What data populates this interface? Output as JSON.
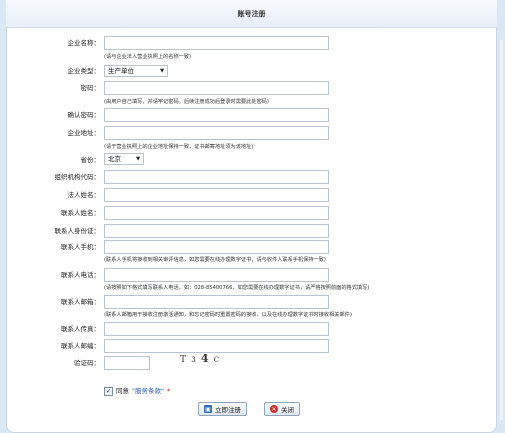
{
  "title": "账号注册",
  "fields": {
    "company_name": {
      "label": "企业名称：",
      "hint": "(请与企业法人营业执照上的名称一致)"
    },
    "company_type": {
      "label": "企业类型：",
      "value": "生产单位"
    },
    "password": {
      "label": "密码：",
      "hint": "(由用户自己填写，并请牢记密码。后续注册成功后登录时需要此处密码)"
    },
    "confirm_password": {
      "label": "确认密码："
    },
    "company_address": {
      "label": "企业地址：",
      "hint": "(请于营业执照上的企业地址保持一致，证书邮寄地址须为该地址)"
    },
    "province": {
      "label": "省份：",
      "value": "北京"
    },
    "org_code": {
      "label": "组织机构代码："
    },
    "legal_person": {
      "label": "法人姓名："
    },
    "contact_name": {
      "label": "联系人姓名："
    },
    "contact_id": {
      "label": "联系人身份证："
    },
    "contact_mobile": {
      "label": "联系人手机：",
      "hint": "(联系人手机将接收到相关审评信息，如您需要在线办理数字证书，请与收件人联系手机保持一致)"
    },
    "contact_phone": {
      "label": "联系人电话：",
      "hint": "(请按照如下格式填写联系人电话，如：028-85400766，如您需要在线办理数字证书，请严格按照前面的格式填写)"
    },
    "contact_email": {
      "label": "联系人邮箱：",
      "hint": "(联系人邮箱用于接收注册激活通知，和忘记密码时重置密码的接收，以及在线办理数字证书时接收相关邮件)"
    },
    "contact_fax": {
      "label": "联系人传真："
    },
    "contact_postcode": {
      "label": "联系人邮编："
    },
    "captcha": {
      "label": "验证码：",
      "text": [
        "T",
        "3",
        "4",
        "C"
      ]
    }
  },
  "agree": {
    "label": "同意",
    "link": "\"服务条款\"",
    "required": "*"
  },
  "buttons": {
    "submit": "立即注册",
    "close": "关闭"
  }
}
